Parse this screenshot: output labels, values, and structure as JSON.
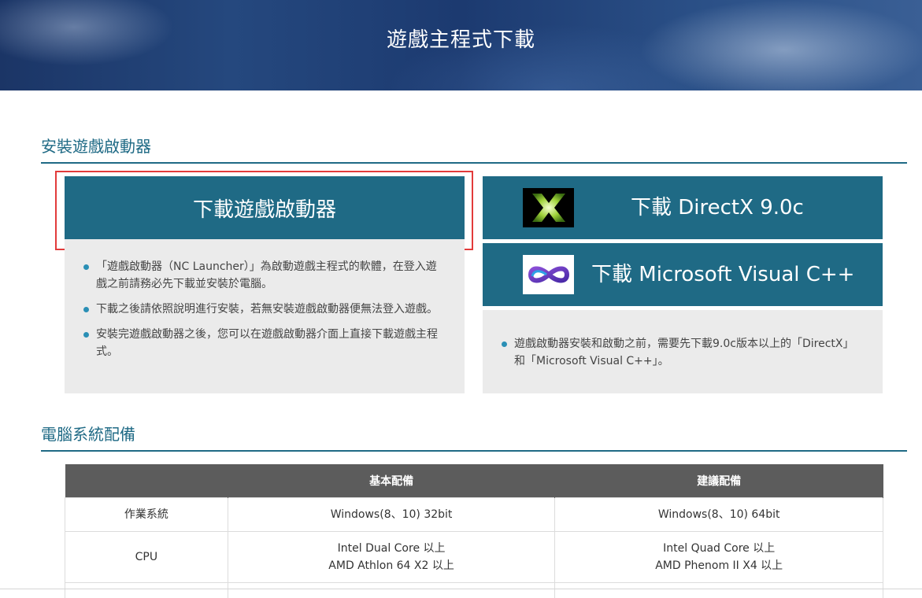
{
  "banner": {
    "title": "遊戲主程式下載"
  },
  "install_section": {
    "title": "安裝遊戲啟動器",
    "launcher_button": "下載遊戲啟動器",
    "directx_button": "下載 DirectX 9.0c",
    "vcpp_button": "下載 Microsoft Visual C++",
    "left_notes": [
      "「遊戲啟動器（NC Launcher）」為啟動遊戲主程式的軟體，在登入遊戲之前請務必先下載並安裝於電腦。",
      "下載之後請依照說明進行安裝，若無安裝遊戲啟動器便無法登入遊戲。",
      "安裝完遊戲啟動器之後，您可以在遊戲啟動器介面上直接下載遊戲主程式。"
    ],
    "right_notes": [
      "遊戲啟動器安裝和啟動之前，需要先下載9.0c版本以上的「DirectX」和「Microsoft Visual C++」。"
    ]
  },
  "spec_section": {
    "title": "電腦系統配備",
    "headers": [
      "",
      "基本配備",
      "建議配備"
    ],
    "rows": [
      {
        "label": "作業系統",
        "basic": "Windows(8、10) 32bit",
        "recommended": "Windows(8、10) 64bit"
      },
      {
        "label": "CPU",
        "basic_line1": "Intel Dual Core 以上",
        "basic_line2": "AMD Athlon 64 X2 以上",
        "recommended_line1": "Intel Quad Core 以上",
        "recommended_line2": "AMD Phenom II X4 以上"
      }
    ]
  },
  "icons": {
    "directx": "directx-logo-icon",
    "vcpp": "visual-cpp-logo-icon"
  },
  "colors": {
    "accent": "#1f6a85",
    "highlight": "#e23b3b",
    "table_header": "#5c5c5c",
    "info_bg": "#ebebeb"
  }
}
